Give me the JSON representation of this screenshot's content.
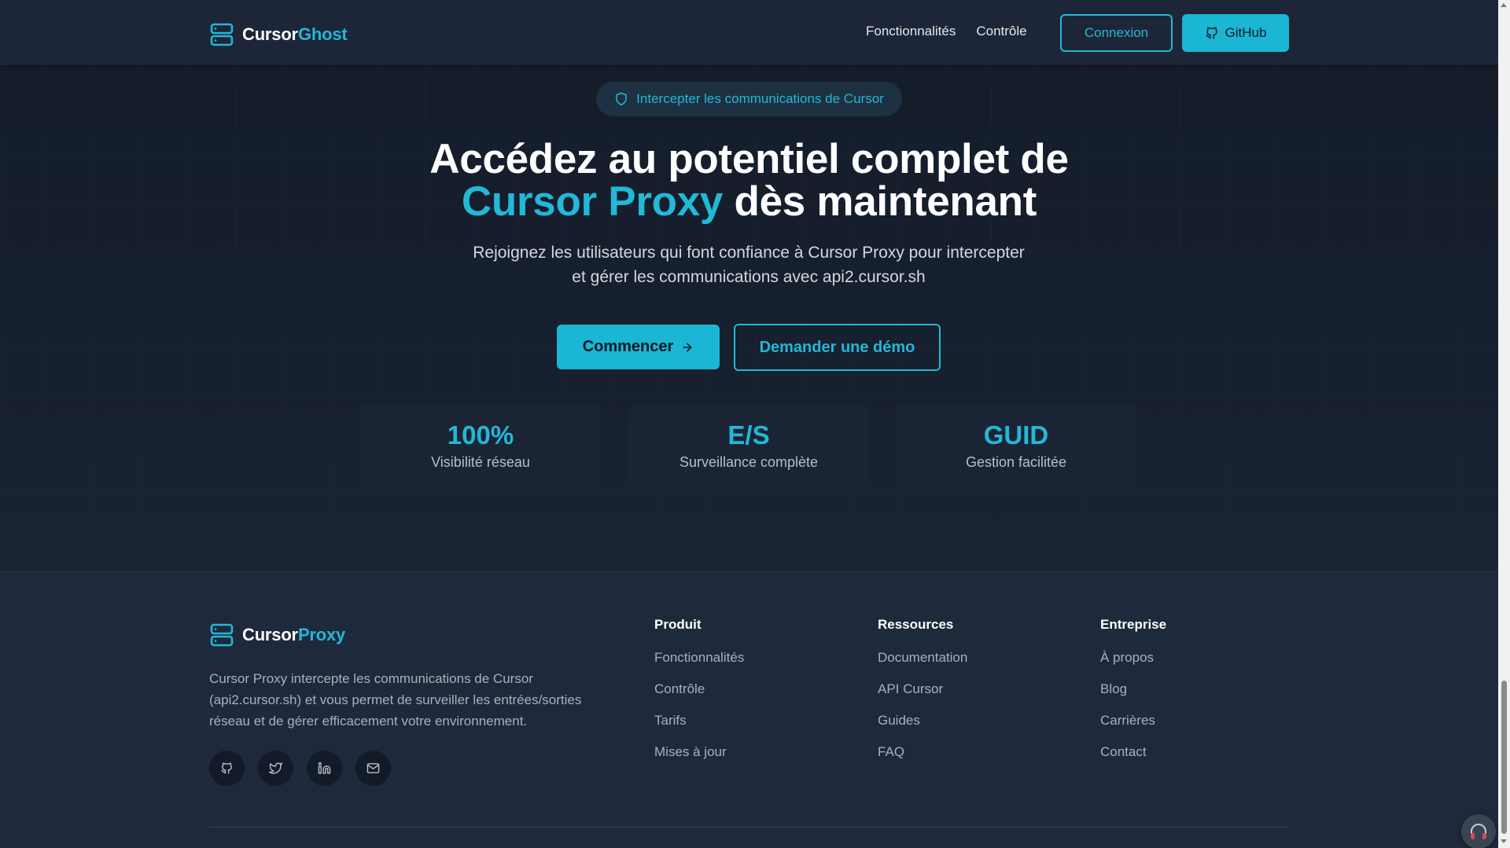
{
  "nav": {
    "brand_primary": "Cursor",
    "brand_accent": "Ghost",
    "links": [
      "Fonctionnalités",
      "Contrôle"
    ],
    "login_label": "Connexion",
    "github_label": "GitHub"
  },
  "hero": {
    "badge": "Intercepter les communications de Cursor",
    "title_line1": "Accédez au potentiel complet de",
    "title_accent": "Cursor Proxy",
    "title_line2_rest": " dès maintenant",
    "subtitle_line1": "Rejoignez les utilisateurs qui font confiance à Cursor Proxy pour intercepter",
    "subtitle_line2": "et gérer les communications avec api2.cursor.sh",
    "cta_primary": "Commencer",
    "cta_secondary": "Demander une démo"
  },
  "stats": [
    {
      "value": "100%",
      "label": "Visibilité réseau"
    },
    {
      "value": "E/S",
      "label": "Surveillance complète"
    },
    {
      "value": "GUID",
      "label": "Gestion facilitée"
    }
  ],
  "footer": {
    "brand_primary": "Cursor",
    "brand_accent": "Proxy",
    "description": "Cursor Proxy intercepte les communications de Cursor (api2.cursor.sh) et vous permet de surveiller les entrées/sorties réseau et de gérer efficacement votre environnement.",
    "socials": [
      "github-icon",
      "twitter-icon",
      "linkedin-icon",
      "mail-icon"
    ],
    "columns": [
      {
        "title": "Produit",
        "links": [
          "Fonctionnalités",
          "Contrôle",
          "Tarifs",
          "Mises à jour"
        ]
      },
      {
        "title": "Ressources",
        "links": [
          "Documentation",
          "API Cursor",
          "Guides",
          "FAQ"
        ]
      },
      {
        "title": "Entreprise",
        "links": [
          "À propos",
          "Blog",
          "Carrières",
          "Contact"
        ]
      }
    ]
  },
  "colors": {
    "accent": "#22b8d6",
    "background": "#1a2332",
    "footer_bg": "#1e293b"
  }
}
